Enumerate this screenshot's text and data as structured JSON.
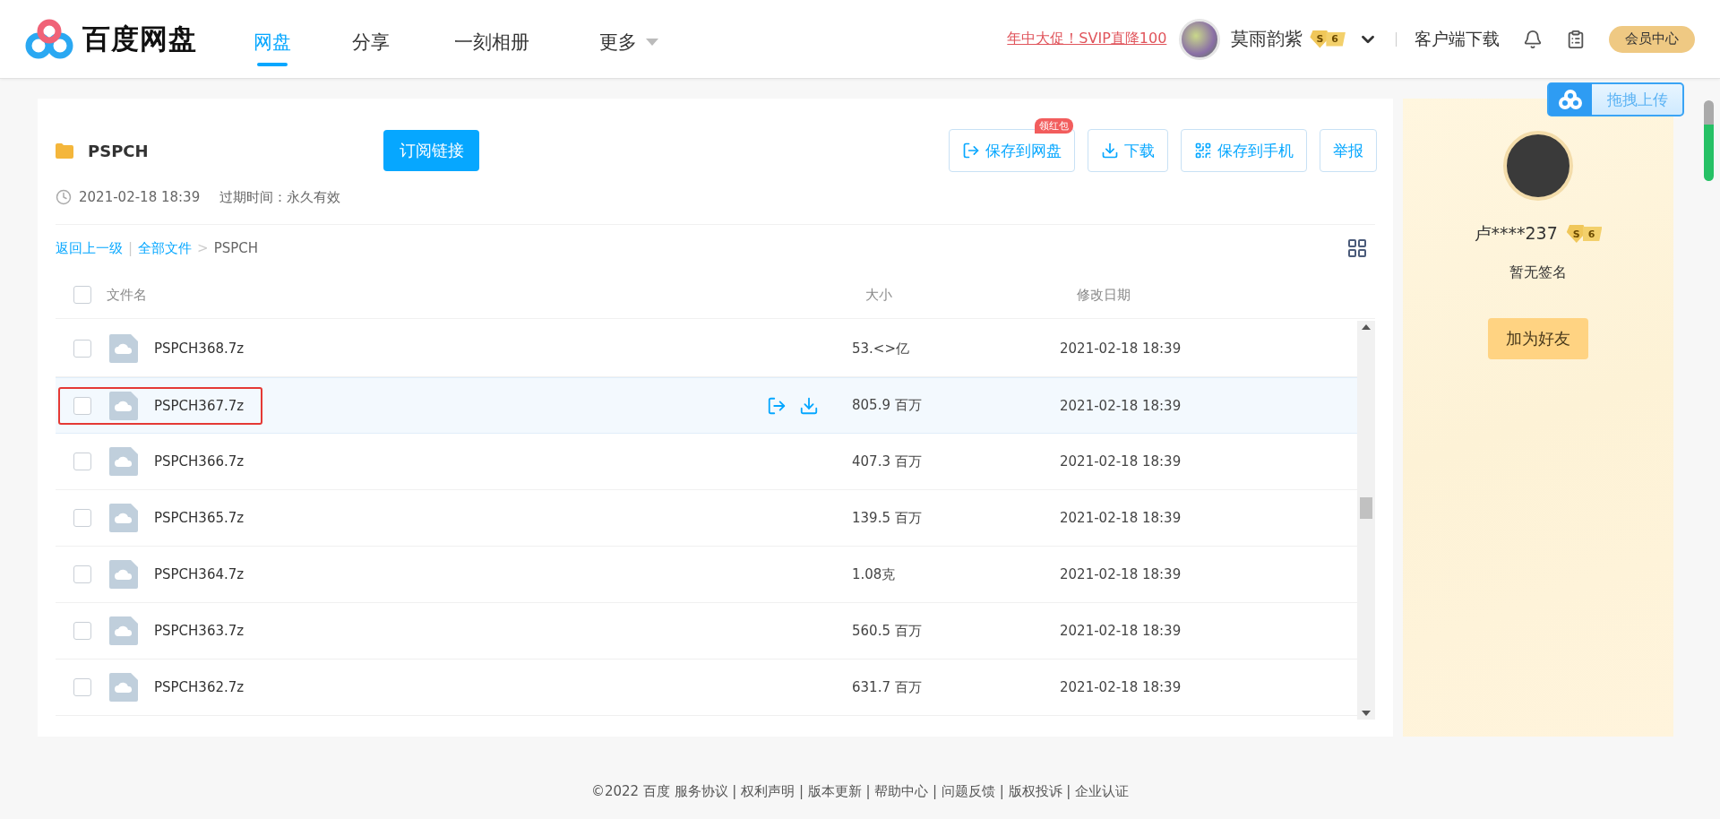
{
  "header": {
    "logo": "百度网盘",
    "nav": [
      {
        "label": "网盘",
        "selected": true
      },
      {
        "label": "分享",
        "selected": false
      },
      {
        "label": "一刻相册",
        "selected": false
      },
      {
        "label": "更多",
        "selected": false,
        "kind": "menu"
      }
    ],
    "promo": "年中大促！SVIP直降100",
    "user": "莫雨韵紫",
    "badge": {
      "letter": "S",
      "level": "6"
    },
    "client_download": "客户端下载",
    "vip_button": "会员中心"
  },
  "upload_button": "拖拽上传",
  "share": {
    "title": "PSPCH",
    "subscribe": "订阅链接",
    "actions": [
      {
        "label": "保存到网盘",
        "kind": "save",
        "tag": "领红包"
      },
      {
        "label": "下载",
        "kind": "download"
      },
      {
        "label": "保存到手机",
        "kind": "phone"
      },
      {
        "label": "举报",
        "kind": "report"
      }
    ],
    "date": "2021-02-18 18:39",
    "expiry": "过期时间：永久有效"
  },
  "breadcrumb": {
    "back": "返回上一级",
    "divider": "|",
    "all": "全部文件",
    "arrow": ">",
    "current": "PSPCH"
  },
  "table": {
    "columns": [
      "文件名",
      "大小",
      "修改日期"
    ],
    "all_checked": false,
    "rows": [
      {
        "name": "PSPCH368.7z",
        "size": "53.<>亿",
        "date": "2021-02-18 18:39",
        "checked": false,
        "hovered": false,
        "annotated": false
      },
      {
        "name": "PSPCH367.7z",
        "size": "805.9 百万",
        "date": "2021-02-18 18:39",
        "checked": false,
        "hovered": true,
        "annotated": true
      },
      {
        "name": "PSPCH366.7z",
        "size": "407.3 百万",
        "date": "2021-02-18 18:39",
        "checked": false,
        "hovered": false,
        "annotated": false
      },
      {
        "name": "PSPCH365.7z",
        "size": "139.5 百万",
        "date": "2021-02-18 18:39",
        "checked": false,
        "hovered": false,
        "annotated": false
      },
      {
        "name": "PSPCH364.7z",
        "size": "1.08克",
        "date": "2021-02-18 18:39",
        "checked": false,
        "hovered": false,
        "annotated": false
      },
      {
        "name": "PSPCH363.7z",
        "size": "560.5 百万",
        "date": "2021-02-18 18:39",
        "checked": false,
        "hovered": false,
        "annotated": false
      },
      {
        "name": "PSPCH362.7z",
        "size": "631.7 百万",
        "date": "2021-02-18 18:39",
        "checked": false,
        "hovered": false,
        "annotated": false
      }
    ]
  },
  "profile": {
    "name": "卢****237",
    "badge": {
      "letter": "S",
      "level": "6"
    },
    "signature": "暂无签名",
    "add_friend": "加为好友"
  },
  "footer": "©2022 百度 服务协议 | 权利声明 | 版本更新 | 帮助中心 | 问题反馈 | 版权投诉 | 企业认证"
}
